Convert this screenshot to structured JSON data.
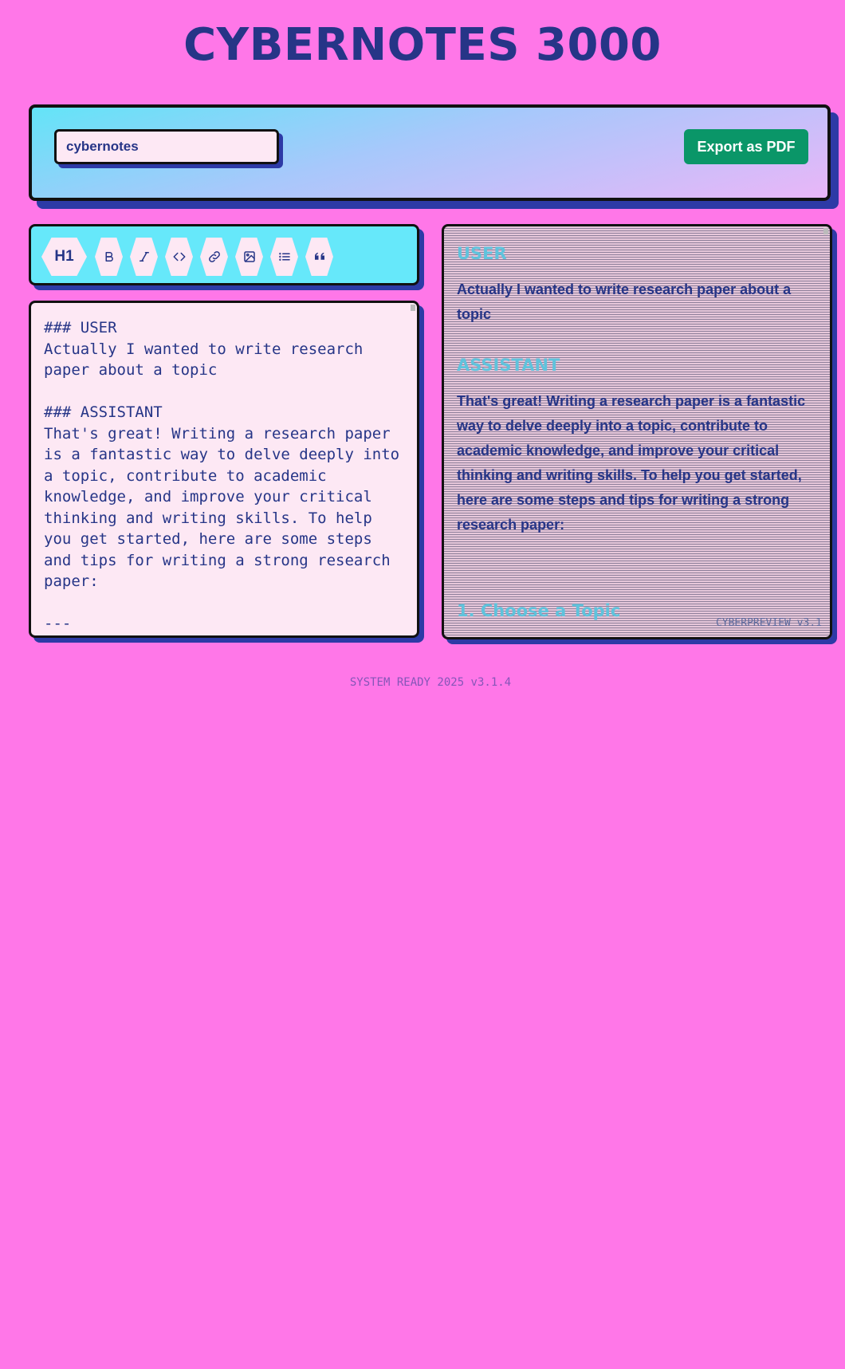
{
  "app": {
    "title": "CYBERNOTES 3000"
  },
  "topbar": {
    "filename_value": "cybernotes",
    "export_label": "Export as PDF"
  },
  "toolbar": {
    "heading_label": "H1",
    "buttons": [
      "heading-icon",
      "bold-icon",
      "italic-icon",
      "code-icon",
      "link-icon",
      "image-icon",
      "list-icon",
      "quote-icon"
    ]
  },
  "editor": {
    "content": "### USER\nActually I wanted to write research paper about a topic\n\n### ASSISTANT\nThat's great! Writing a research paper is a fantastic way to delve deeply into a topic, contribute to academic knowledge, and improve your critical thinking and writing skills. To help you get started, here are some steps and tips for writing a strong research paper:\n\n---"
  },
  "preview": {
    "sections": [
      {
        "heading": "USER",
        "body": "Actually I wanted to write research paper about a topic"
      },
      {
        "heading": "ASSISTANT",
        "body": "That's great! Writing a research paper is a fantastic way to delve deeply into a topic, contribute to academic knowledge, and improve your critical thinking and writing skills. To help you get started, here are some steps and tips for writing a strong research paper:"
      }
    ],
    "cut_heading": "1. Choose a Topic",
    "version": "CYBERPREVIEW v3.1"
  },
  "footer": {
    "text": "SYSTEM READY 2025 v3.1.4"
  },
  "colors": {
    "background": "#ff77e8",
    "primary": "#263587",
    "accent_cyan": "#66e8fa",
    "export_green": "#0a9668",
    "shadow": "#2d3aa6"
  }
}
